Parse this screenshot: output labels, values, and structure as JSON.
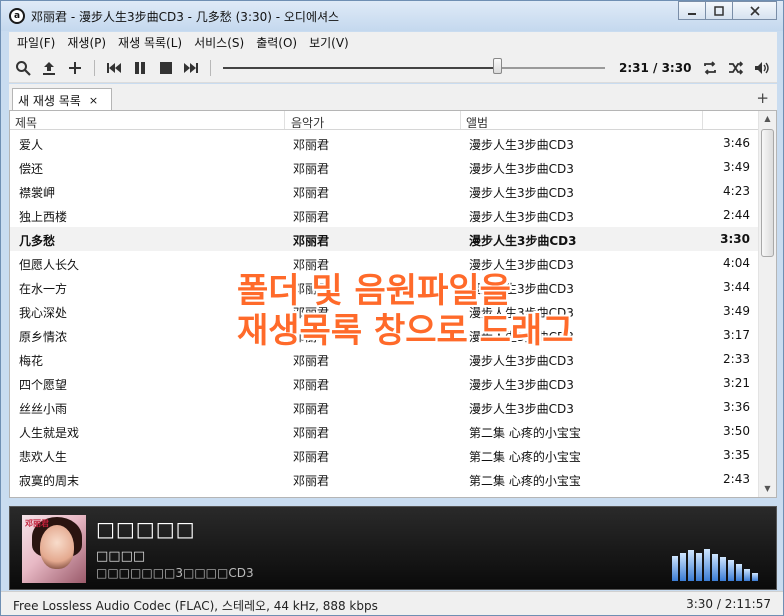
{
  "window": {
    "title": "邓丽君 - 漫步人生3步曲CD3 - 几多愁 (3:30) - 오디에셔스",
    "app_icon_letter": "a"
  },
  "menu": [
    "파일(F)",
    "재생(P)",
    "재생 목록(L)",
    "서비스(S)",
    "출력(O)",
    "보기(V)"
  ],
  "toolbar": {
    "time": "2:31 / 3:30",
    "progress": 0.719
  },
  "tabs": [
    {
      "label": "새 재생 목록",
      "close": "×"
    }
  ],
  "tab_add": "+",
  "columns": {
    "title": "제목",
    "artist": "음악가",
    "album": "앨범"
  },
  "tracks": [
    {
      "title": "爱人",
      "artist": "邓丽君",
      "album": "漫步人生3步曲CD3",
      "duration": "3:46"
    },
    {
      "title": "偿还",
      "artist": "邓丽君",
      "album": "漫步人生3步曲CD3",
      "duration": "3:49"
    },
    {
      "title": "襟裳岬",
      "artist": "邓丽君",
      "album": "漫步人生3步曲CD3",
      "duration": "4:23"
    },
    {
      "title": "独上西楼",
      "artist": "邓丽君",
      "album": "漫步人生3步曲CD3",
      "duration": "2:44"
    },
    {
      "title": "几多愁",
      "artist": "邓丽君",
      "album": "漫步人生3步曲CD3",
      "duration": "3:30",
      "current": true
    },
    {
      "title": "但愿人长久",
      "artist": "邓丽君",
      "album": "漫步人生3步曲CD3",
      "duration": "4:04"
    },
    {
      "title": "在水一方",
      "artist": "邓丽君",
      "album": "漫步人生3步曲CD3",
      "duration": "3:44"
    },
    {
      "title": "我心深处",
      "artist": "邓丽君",
      "album": "漫步人生3步曲CD3",
      "duration": "3:49"
    },
    {
      "title": "原乡情浓",
      "artist": "邓丽君",
      "album": "漫步人生3步曲CD3",
      "duration": "3:17"
    },
    {
      "title": "梅花",
      "artist": "邓丽君",
      "album": "漫步人生3步曲CD3",
      "duration": "2:33"
    },
    {
      "title": "四个愿望",
      "artist": "邓丽君",
      "album": "漫步人生3步曲CD3",
      "duration": "3:21"
    },
    {
      "title": "丝丝小雨",
      "artist": "邓丽君",
      "album": "漫步人生3步曲CD3",
      "duration": "3:36"
    },
    {
      "title": " 人生就是戏",
      "artist": "邓丽君",
      "album": "第二集 心疼的小宝宝",
      "duration": "3:50"
    },
    {
      "title": "悲欢人生",
      "artist": "邓丽君",
      "album": "第二集 心疼的小宝宝",
      "duration": "3:35"
    },
    {
      "title": "寂寞的周末",
      "artist": "邓丽君",
      "album": "第二集 心疼的小宝宝",
      "duration": "2:43"
    }
  ],
  "overlay": {
    "line1": "폴더 및 음원파일을",
    "line2": "재생목록 창으로 드래그"
  },
  "now_playing": {
    "title": "□□□□□",
    "artist": "□□□□",
    "album": "□□□□□□□3□□□□CD3",
    "cover_text": "邓丽君"
  },
  "visualizer_levels": [
    0.45,
    0.5,
    0.55,
    0.5,
    0.58,
    0.48,
    0.42,
    0.38,
    0.3,
    0.22,
    0.15
  ],
  "status": {
    "codec": "Free Lossless Audio Codec (FLAC), 스테레오, 44 kHz, 888 kbps",
    "time": "3:30 / 2:11:57"
  },
  "colors": {
    "overlay_text": "#ff6a2a",
    "visualizer": "#3b7cd4"
  }
}
